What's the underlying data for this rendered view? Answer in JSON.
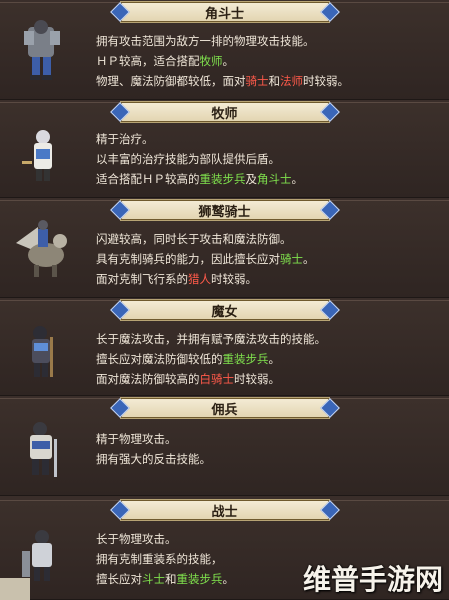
{
  "classes": [
    {
      "name": "角斗士",
      "lines": [
        [
          {
            "t": "拥有攻击范围为敌方一排的物理攻击技能。"
          }
        ],
        [
          {
            "t": "ＨＰ较高，适合搭配"
          },
          {
            "t": "牧师",
            "c": "hl-green"
          },
          {
            "t": "。"
          }
        ],
        [
          {
            "t": "物理、魔法防御都较低，面对"
          },
          {
            "t": "骑士",
            "c": "hl-red"
          },
          {
            "t": "和"
          },
          {
            "t": "法师",
            "c": "hl-red"
          },
          {
            "t": "时较弱。"
          }
        ]
      ]
    },
    {
      "name": "牧师",
      "lines": [
        [
          {
            "t": "精于治疗。"
          }
        ],
        [
          {
            "t": "以丰富的治疗技能为部队提供后盾。"
          }
        ],
        [
          {
            "t": "适合搭配ＨＰ较高的"
          },
          {
            "t": "重装步兵",
            "c": "hl-green"
          },
          {
            "t": "及"
          },
          {
            "t": "角斗士",
            "c": "hl-green"
          },
          {
            "t": "。"
          }
        ]
      ]
    },
    {
      "name": "狮鹫骑士",
      "lines": [
        [
          {
            "t": "闪避较高，同时长于攻击和魔法防御。"
          }
        ],
        [
          {
            "t": "具有克制骑兵的能力，因此擅长应对"
          },
          {
            "t": "骑士",
            "c": "hl-green"
          },
          {
            "t": "。"
          }
        ],
        [
          {
            "t": "面对克制飞行系的"
          },
          {
            "t": "猎人",
            "c": "hl-red"
          },
          {
            "t": "时较弱。"
          }
        ]
      ]
    },
    {
      "name": "魔女",
      "lines": [
        [
          {
            "t": "长于魔法攻击，并拥有赋予魔法攻击的技能。"
          }
        ],
        [
          {
            "t": "擅长应对魔法防御较低的"
          },
          {
            "t": "重装步兵",
            "c": "hl-green"
          },
          {
            "t": "。"
          }
        ],
        [
          {
            "t": "面对魔法防御较高的"
          },
          {
            "t": "白骑士",
            "c": "hl-red"
          },
          {
            "t": "时较弱。"
          }
        ]
      ]
    },
    {
      "name": "佣兵",
      "lines": [
        [
          {
            "t": "精于物理攻击。"
          }
        ],
        [
          {
            "t": "拥有强大的反击技能。"
          }
        ]
      ]
    },
    {
      "name": "战士",
      "lines": [
        [
          {
            "t": "长于物理攻击。"
          }
        ],
        [
          {
            "t": "拥有克制重装系的技能，"
          }
        ],
        [
          {
            "t": "擅长应对"
          },
          {
            "t": "斗士",
            "c": "hl-green"
          },
          {
            "t": "和"
          },
          {
            "t": "重装步兵",
            "c": "hl-green"
          },
          {
            "t": "。"
          }
        ]
      ]
    }
  ],
  "watermark": "维普手游网",
  "colors": {
    "panel_bg": "#3a2e2a",
    "banner_bg": "#efe4c8",
    "banner_gem": "#3a66b8",
    "highlight_good": "#7fe04d",
    "highlight_bad": "#ff5a4a"
  }
}
